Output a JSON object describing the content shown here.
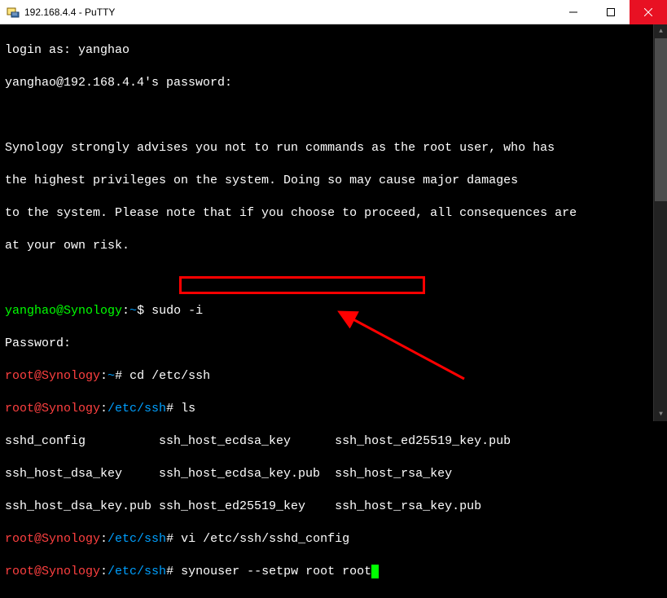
{
  "window": {
    "title": "192.168.4.4 - PuTTY"
  },
  "terminal": {
    "login_prompt": "login as: ",
    "login_user": "yanghao",
    "pw_prompt_user": "yanghao@192.168.4.4",
    "pw_prompt_suffix": "'s password:",
    "warning_l1": "Synology strongly advises you not to run commands as the root user, who has",
    "warning_l2": "the highest privileges on the system. Doing so may cause major damages",
    "warning_l3": "to the system. Please note that if you choose to proceed, all consequences are",
    "warning_l4": "at your own risk.",
    "prompt1_user": "yanghao@Synology",
    "prompt1_sep": ":",
    "prompt1_path": "~",
    "prompt1_char": "$ ",
    "cmd1": "sudo -i",
    "password_label": "Password:",
    "prompt2_user": "root@Synology",
    "prompt2_sep": ":",
    "prompt2_path": "~",
    "prompt2_char": "# ",
    "cmd2": "cd /etc/ssh",
    "prompt3_user": "root@Synology",
    "prompt3_sep": ":",
    "prompt3_path": "/etc/ssh",
    "prompt3_char": "# ",
    "cmd3": "ls",
    "ls_l1": "sshd_config          ssh_host_ecdsa_key      ssh_host_ed25519_key.pub",
    "ls_l2": "ssh_host_dsa_key     ssh_host_ecdsa_key.pub  ssh_host_rsa_key",
    "ls_l3": "ssh_host_dsa_key.pub ssh_host_ed25519_key    ssh_host_rsa_key.pub",
    "prompt4_user": "root@Synology",
    "prompt4_sep": ":",
    "prompt4_path": "/etc/ssh",
    "prompt4_char": "# ",
    "cmd4": "vi /etc/ssh/sshd_config",
    "prompt5_user": "root@Synology",
    "prompt5_sep": ":",
    "prompt5_path": "/etc/ssh",
    "prompt5_char": "# ",
    "cmd5": "synouser --setpw root root"
  }
}
